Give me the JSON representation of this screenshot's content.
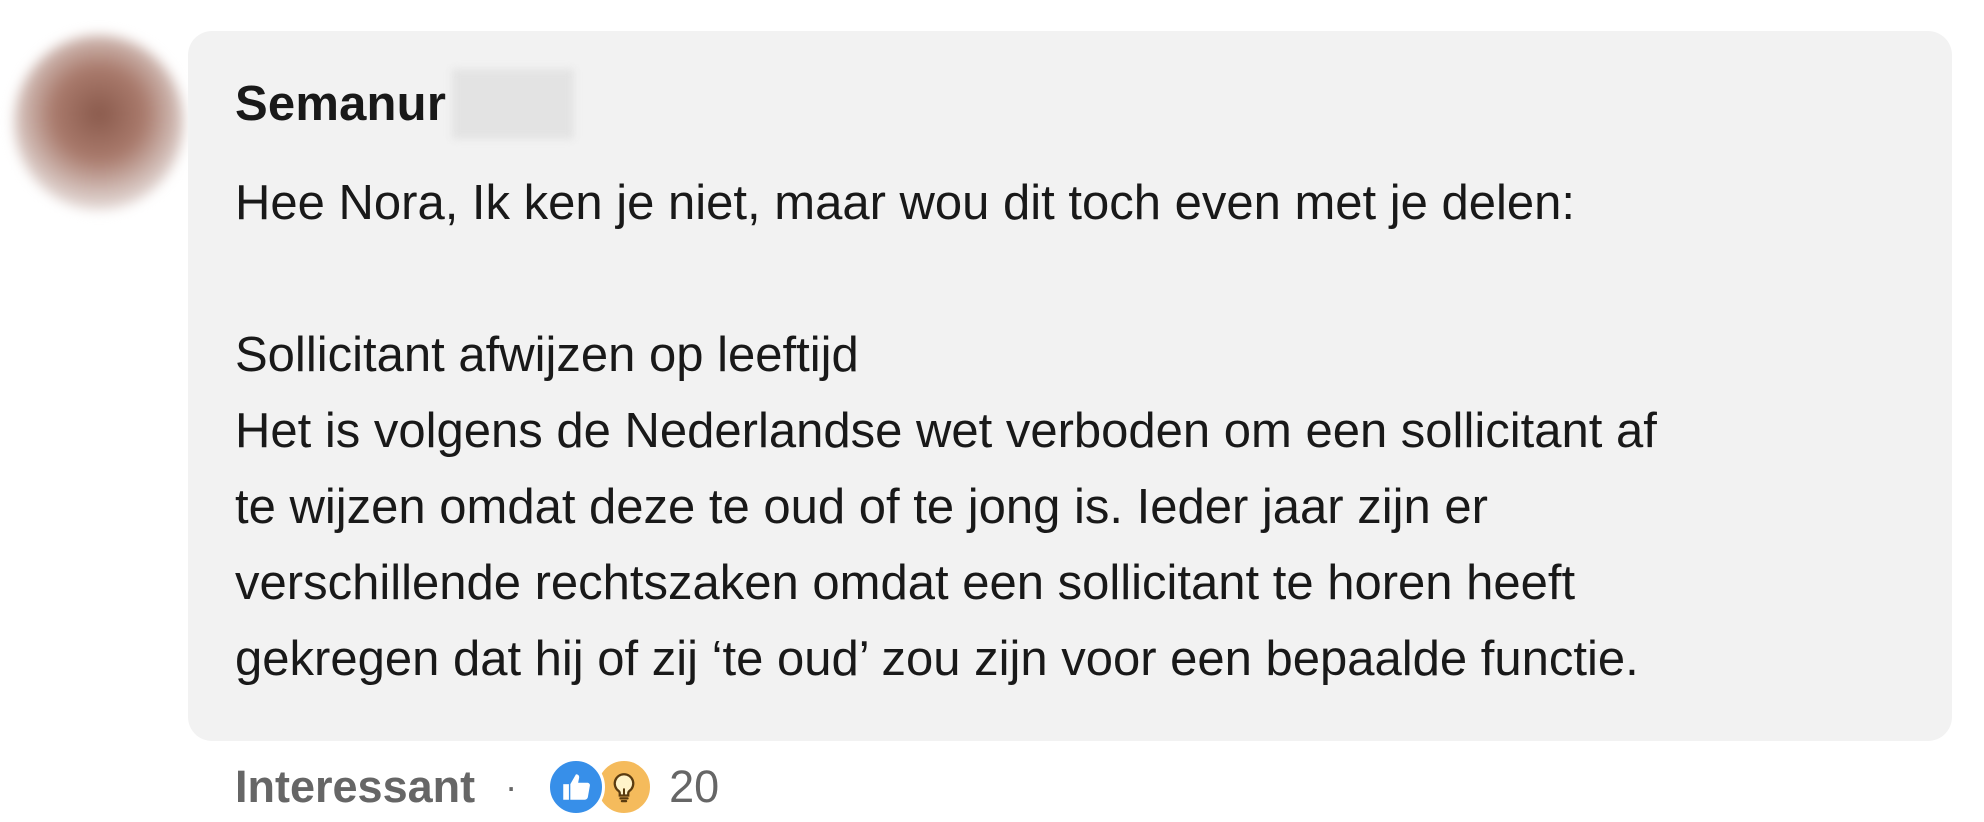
{
  "comment": {
    "author_first_name": "Semanur",
    "lines": [
      "Hee Nora, Ik ken je niet, maar wou dit toch even met je delen:",
      "",
      "Sollicitant afwijzen op leeftijd",
      "Het is volgens de Nederlandse wet verboden om een sollicitant af",
      "te wijzen omdat deze te oud of te jong is. Ieder jaar zijn er",
      "verschillende rechtszaken omdat een sollicitant te horen heeft",
      "gekregen dat hij of zij ‘te oud’ zou zijn voor een bepaalde functie."
    ]
  },
  "actions": {
    "reaction_label": "Interessant",
    "separator": "·",
    "reaction_count": "20",
    "reaction_icons": [
      "like-icon",
      "insightful-lightbulb-icon"
    ]
  },
  "colors": {
    "bubble_bg": "#f2f2f2",
    "text": "#191919",
    "muted": "#666666",
    "like_blue": "#378fe9",
    "insight_yellow": "#f5bb5c"
  }
}
